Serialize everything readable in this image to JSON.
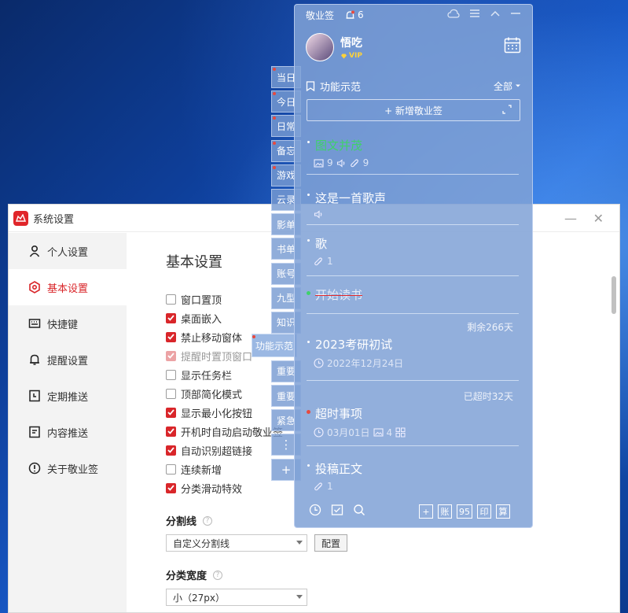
{
  "settings": {
    "title": "系统设置",
    "sidebar": [
      {
        "label": "个人设置",
        "icon": "user-icon",
        "active": false
      },
      {
        "label": "基本设置",
        "icon": "gear-icon",
        "active": true
      },
      {
        "label": "快捷键",
        "icon": "keyboard-icon",
        "active": false
      },
      {
        "label": "提醒设置",
        "icon": "bell-icon",
        "active": false
      },
      {
        "label": "定期推送",
        "icon": "clock-doc-icon",
        "active": false
      },
      {
        "label": "内容推送",
        "icon": "doc-icon",
        "active": false
      },
      {
        "label": "关于敬业签",
        "icon": "info-icon",
        "active": false
      }
    ],
    "heading": "基本设置",
    "options": [
      {
        "label": "窗口置顶",
        "checked": false,
        "disabled": false
      },
      {
        "label": "桌面嵌入",
        "checked": true,
        "disabled": false
      },
      {
        "label": "禁止移动窗体",
        "checked": true,
        "disabled": false
      },
      {
        "label": "提醒时置顶窗口",
        "checked": true,
        "disabled": true
      },
      {
        "label": "显示任务栏",
        "checked": false,
        "disabled": false
      },
      {
        "label": "顶部简化模式",
        "checked": false,
        "disabled": false
      },
      {
        "label": "显示最小化按钮",
        "checked": true,
        "disabled": false
      },
      {
        "label": "开机时自动启动敬业签",
        "checked": true,
        "disabled": false
      },
      {
        "label": "自动识别超链接",
        "checked": true,
        "disabled": false
      },
      {
        "label": "连续新增",
        "checked": false,
        "disabled": false
      },
      {
        "label": "分类滑动特效",
        "checked": true,
        "disabled": false
      }
    ],
    "divider": {
      "label": "分割线",
      "help": "?",
      "value": "自定义分割线",
      "button": "配置"
    },
    "width": {
      "label": "分类宽度",
      "help": "?",
      "value": "小（27px）"
    }
  },
  "tabs": [
    "当日",
    "今日",
    "日常",
    "备忘",
    "游戏",
    "云录",
    "影单",
    "书单",
    "账号",
    "九型",
    "知识",
    "重要",
    "重要",
    "紧急"
  ],
  "tab_dots": [
    1,
    2,
    3,
    4,
    5
  ],
  "active_tab": "功能示范",
  "tab_more": "⋮",
  "tab_add": "+",
  "panel": {
    "app_name": "敬业签",
    "notify_count": "6",
    "username": "悟吃",
    "vip": "VIP",
    "category": "功能示范",
    "filter": "全部",
    "add_button": "+ 新增敬业签",
    "notes": [
      {
        "title": "图文并茂",
        "meta": [
          "9",
          "9"
        ],
        "green": true
      },
      {
        "title": "这是一首歌声"
      },
      {
        "title": "歌",
        "meta": [
          "1"
        ]
      },
      {
        "title": "开始读书",
        "done": true
      },
      {
        "title": "2023考研初试",
        "right": "剩余266天",
        "date": "2022年12月24日"
      },
      {
        "title": "超时事项",
        "right": "已超时32天",
        "date": "03月01日",
        "count": "4"
      },
      {
        "title": "投稿正文",
        "meta": [
          "1"
        ]
      }
    ],
    "footer_buttons": [
      "+",
      "账",
      "95",
      "印",
      "算"
    ]
  },
  "colors": {
    "accent": "#d9262a",
    "panel": "#809ed6",
    "done_strike": "#e0262a"
  }
}
